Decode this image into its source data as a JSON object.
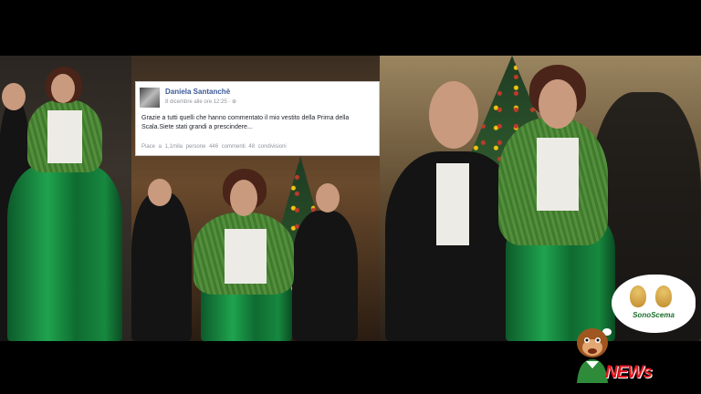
{
  "post": {
    "author": "Daniela Santanchè",
    "date": "8 dicembre alle ore 12:25 · ⊕",
    "text": "Grazie a tutti quelli che hanno commentato il mio vestito della Prima della Scala.Siete stati grandi a prescindere...",
    "stats": "Piace a 1,1mila persone  446 commenti  48 condivisioni"
  },
  "logo": {
    "text": "SonoScema",
    "news": "NEWs"
  }
}
